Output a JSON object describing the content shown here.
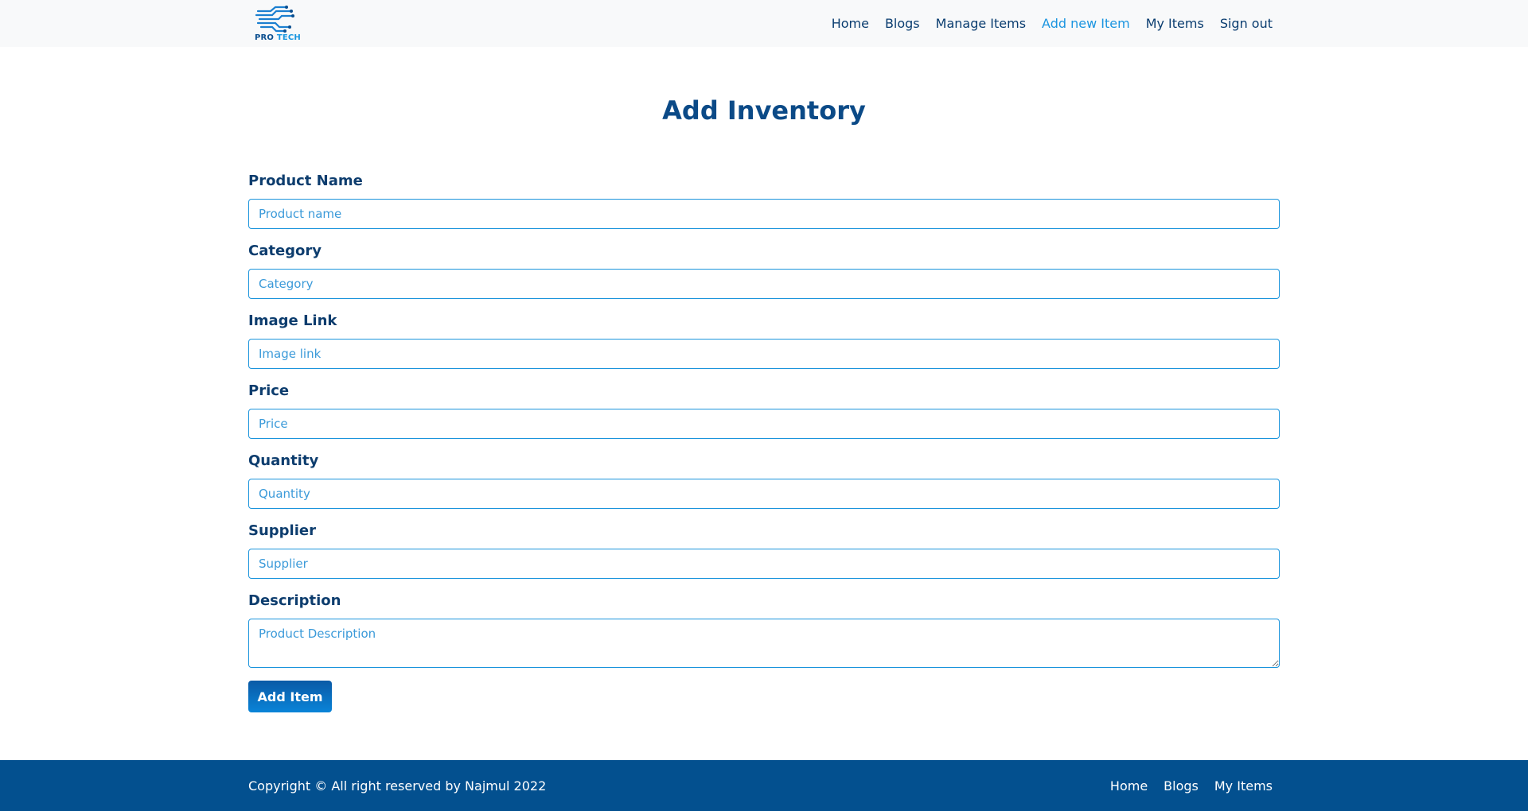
{
  "brand": {
    "logo_text_1": "PRO",
    "logo_text_2": "TECH",
    "primary_color": "#0b4a87",
    "accent_color": "#1b95e0"
  },
  "nav": {
    "items": [
      {
        "label": "Home",
        "active": false
      },
      {
        "label": "Blogs",
        "active": false
      },
      {
        "label": "Manage Items",
        "active": false
      },
      {
        "label": "Add new Item",
        "active": true
      },
      {
        "label": "My Items",
        "active": false
      },
      {
        "label": "Sign out",
        "active": false
      }
    ]
  },
  "page": {
    "title": "Add Inventory"
  },
  "form": {
    "product_name": {
      "label": "Product Name",
      "placeholder": "Product name",
      "value": ""
    },
    "category": {
      "label": "Category",
      "placeholder": "Category",
      "value": ""
    },
    "image_link": {
      "label": "Image Link",
      "placeholder": "Image link",
      "value": ""
    },
    "price": {
      "label": "Price",
      "placeholder": "Price",
      "value": ""
    },
    "quantity": {
      "label": "Quantity",
      "placeholder": "Quantity",
      "value": ""
    },
    "supplier": {
      "label": "Supplier",
      "placeholder": "Supplier",
      "value": ""
    },
    "description": {
      "label": "Description",
      "placeholder": "Product Description",
      "value": ""
    },
    "submit_label": "Add Item"
  },
  "footer": {
    "copyright": "Copyright © All right reserved by Najmul 2022",
    "links": [
      {
        "label": "Home"
      },
      {
        "label": "Blogs"
      },
      {
        "label": "My Items"
      }
    ],
    "background_color": "#03508f"
  }
}
